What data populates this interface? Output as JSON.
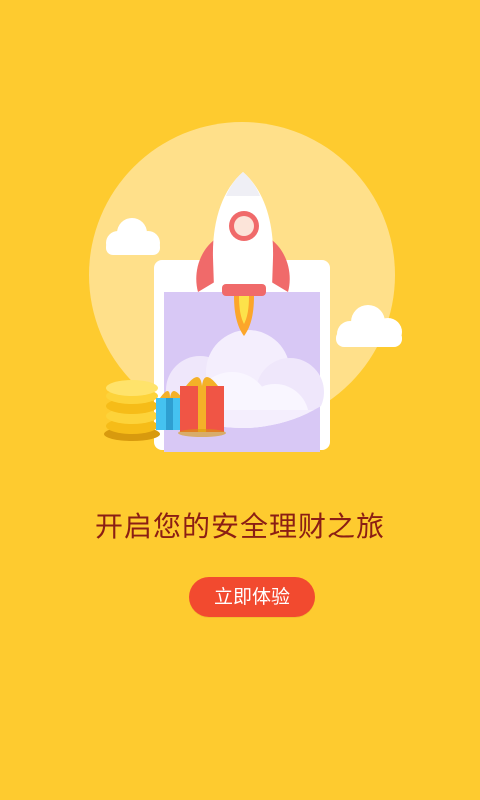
{
  "splash": {
    "tagline": "开启您的安全理财之旅",
    "cta_label": "立即体验"
  },
  "colors": {
    "background": "#FECB2F",
    "circle": "#FFE08A",
    "tagline": "#8B1E14",
    "button": "#F24A2F",
    "button_text": "#FFFFFF"
  },
  "icons": [
    "rocket-icon",
    "cloud-icon",
    "coins-icon",
    "gift-icon",
    "screen-icon"
  ]
}
